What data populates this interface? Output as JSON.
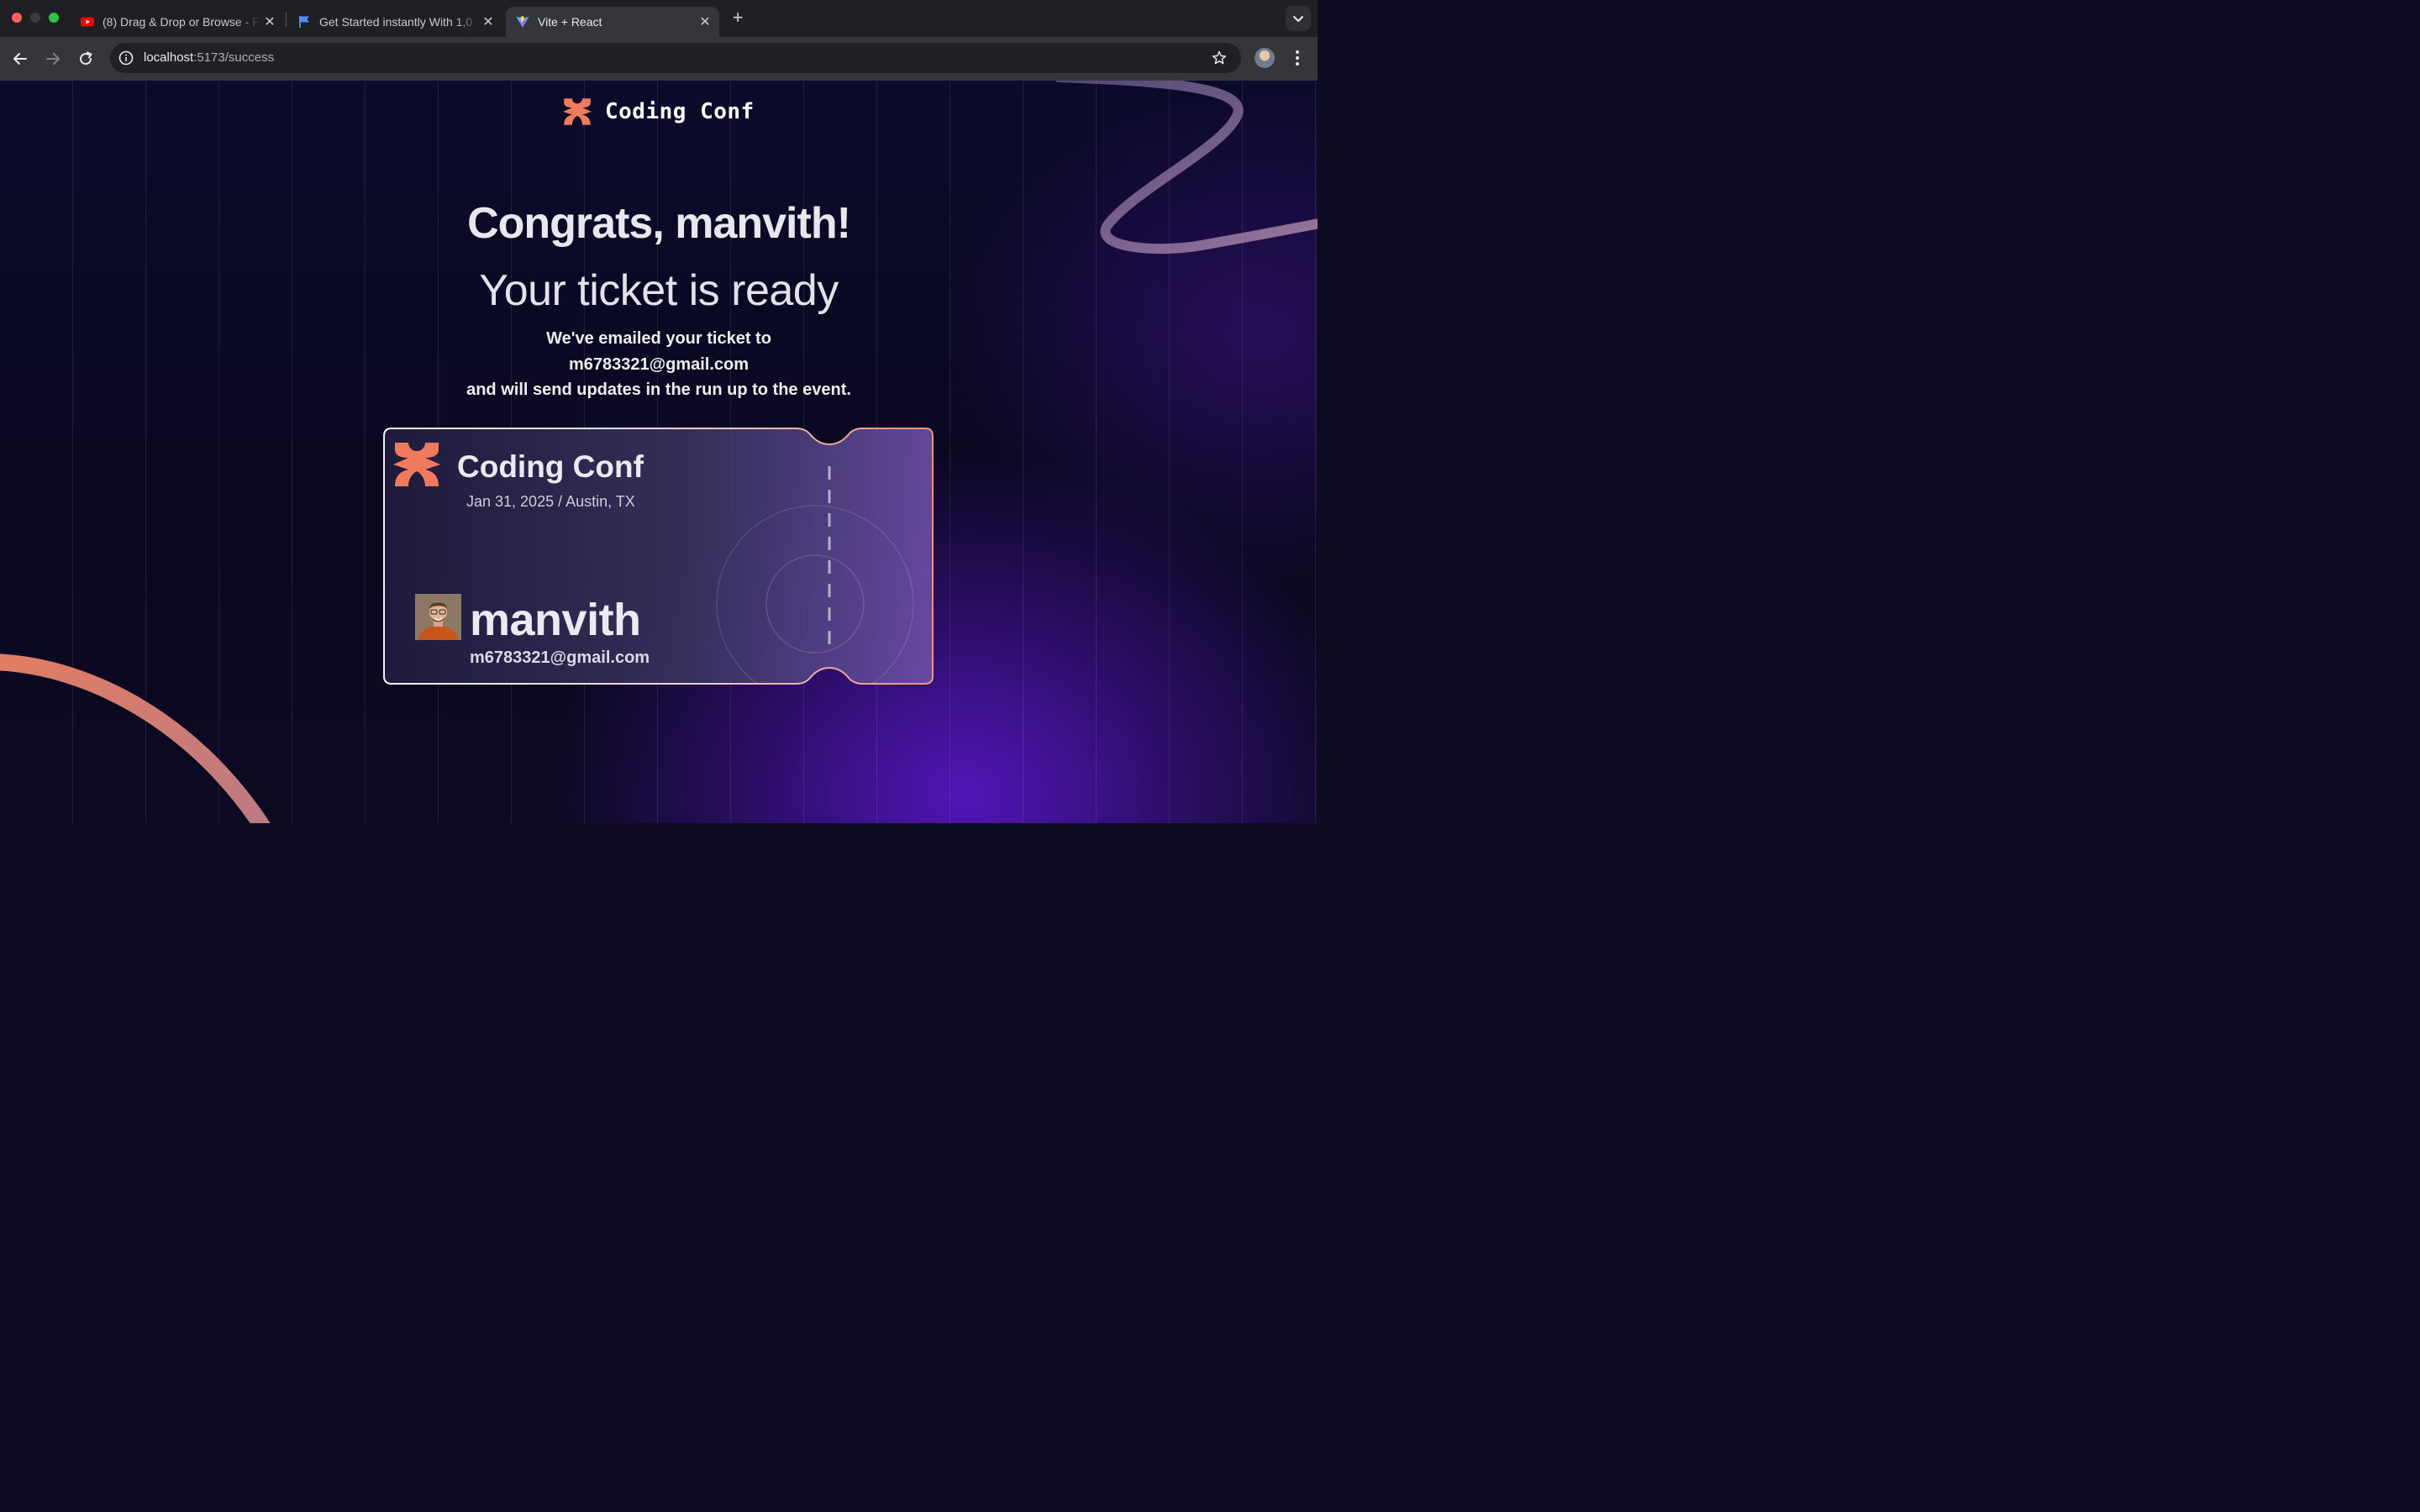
{
  "browser": {
    "tabs": [
      {
        "title": "(8) Drag & Drop or Browse - F",
        "favicon": "youtube-icon",
        "active": false
      },
      {
        "title": "Get Started instantly With 1,0",
        "favicon": "flag-icon",
        "active": false
      },
      {
        "title": "Vite + React",
        "favicon": "vite-icon",
        "active": true
      }
    ],
    "url_host": "localhost",
    "url_path": ":5173/success"
  },
  "page": {
    "brand": "Coding Conf",
    "headline": "Congrats, manvith!",
    "subheadline": "Your ticket is ready",
    "message_line1": "We've emailed your ticket to",
    "message_email": "m6783321@gmail.com",
    "message_line2": "and will send updates in the run up to the event."
  },
  "ticket": {
    "event": "Coding Conf",
    "date_location": "Jan 31, 2025 / Austin, TX",
    "attendee_name": "manvith",
    "attendee_email": "m6783321@gmail.com"
  },
  "colors": {
    "accent": "#f07a5c",
    "background": "#0b0a2a",
    "purple_glow": "#5416be"
  }
}
